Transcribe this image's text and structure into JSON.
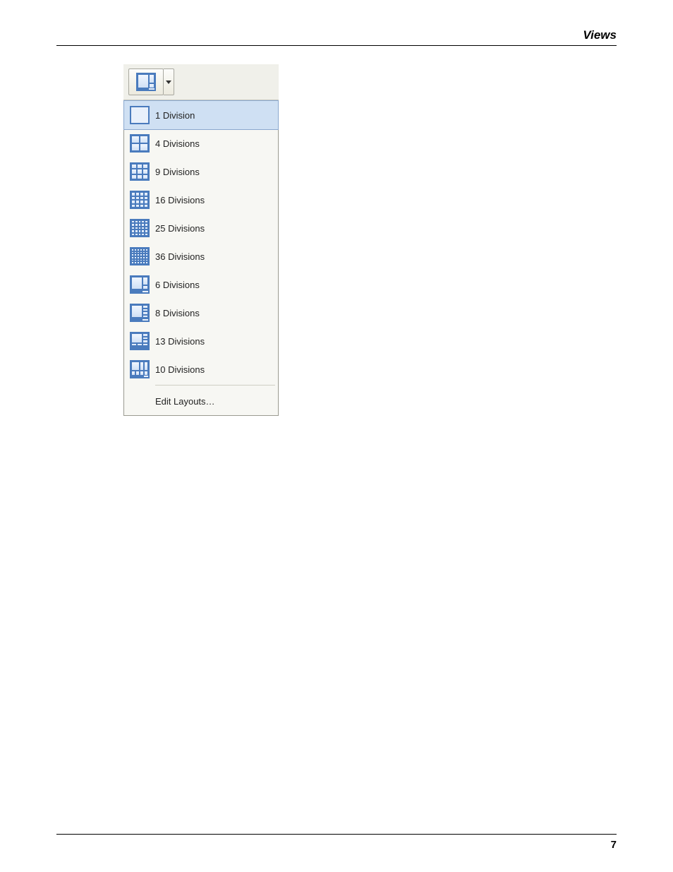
{
  "header": {
    "title": "Views"
  },
  "footer": {
    "page": "7"
  },
  "menu": {
    "items": [
      {
        "label": "1 Division"
      },
      {
        "label": "4 Divisions"
      },
      {
        "label": "9 Divisions"
      },
      {
        "label": "16 Divisions"
      },
      {
        "label": "25 Divisions"
      },
      {
        "label": "36 Divisions"
      },
      {
        "label": "6 Divisions"
      },
      {
        "label": "8 Divisions"
      },
      {
        "label": "13 Divisions"
      },
      {
        "label": "10 Divisions"
      }
    ],
    "edit": "Edit Layouts…"
  }
}
